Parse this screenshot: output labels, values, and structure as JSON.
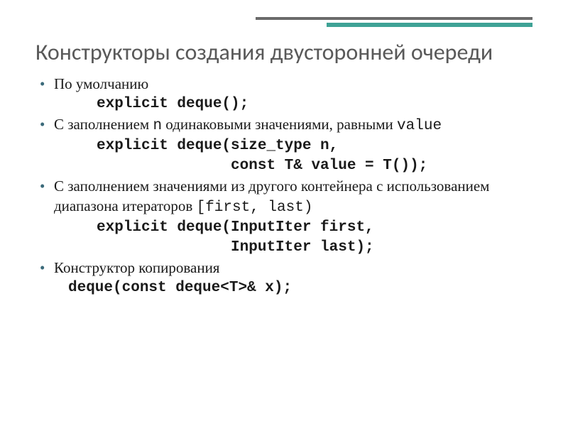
{
  "title": "Конструкторы создания двусторонней очереди",
  "items": [
    {
      "text": "По умолчанию",
      "code": [
        "explicit deque();"
      ]
    },
    {
      "text_pre": "С заполнением ",
      "inline_code": "n",
      "text_mid": " одинаковыми значениями, равными ",
      "inline_code2": "value",
      "code": [
        "explicit deque(size_type n,",
        "               const T& value = T());"
      ]
    },
    {
      "text_pre": "С заполнением значениями из другого контейнера с использованием диапазона итераторов ",
      "inline_code": "[first, last)",
      "code": [
        "explicit deque(InputIter first,",
        "               InputIter last);"
      ]
    },
    {
      "text": "Конструктор копирования",
      "code": [
        "deque(const deque<T>& x);"
      ],
      "code_left": true
    }
  ]
}
